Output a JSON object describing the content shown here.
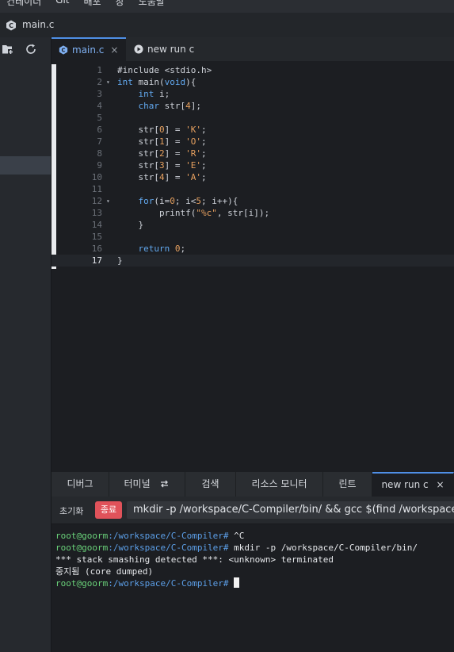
{
  "menu": {
    "items": [
      "컨테이너",
      "Git",
      "배포",
      "창",
      "도움말"
    ]
  },
  "window": {
    "title": "main.c"
  },
  "editor_tabs": [
    {
      "label": "main.c",
      "close": "×",
      "active": true
    },
    {
      "label": "new run c",
      "active": false
    }
  ],
  "code_lines": [
    {
      "n": "1",
      "fold": "",
      "html": "#include &lt;stdio.h&gt;"
    },
    {
      "n": "2",
      "fold": "▾",
      "html": "<span class='kw'>int</span> main(<span class='kw'>void</span>){"
    },
    {
      "n": "3",
      "fold": "",
      "html": "    <span class='kw'>int</span> i;"
    },
    {
      "n": "4",
      "fold": "",
      "html": "    <span class='kw'>char</span> str[<span class='num'>4</span>];"
    },
    {
      "n": "5",
      "fold": "",
      "html": ""
    },
    {
      "n": "6",
      "fold": "",
      "html": "    str[<span class='num'>0</span>] = <span class='str'>'K'</span>;"
    },
    {
      "n": "7",
      "fold": "",
      "html": "    str[<span class='num'>1</span>] = <span class='str'>'O'</span>;"
    },
    {
      "n": "8",
      "fold": "",
      "html": "    str[<span class='num'>2</span>] = <span class='str'>'R'</span>;"
    },
    {
      "n": "9",
      "fold": "",
      "html": "    str[<span class='num'>3</span>] = <span class='str'>'E'</span>;"
    },
    {
      "n": "10",
      "fold": "",
      "html": "    str[<span class='num'>4</span>] = <span class='str'>'A'</span>;"
    },
    {
      "n": "11",
      "fold": "",
      "html": ""
    },
    {
      "n": "12",
      "fold": "▾",
      "html": "    <span class='kw'>for</span>(i=<span class='num'>0</span>; i&lt;<span class='num'>5</span>; i++){"
    },
    {
      "n": "13",
      "fold": "",
      "html": "        printf(<span class='str'>\"%c\"</span>, str[i]);"
    },
    {
      "n": "14",
      "fold": "",
      "html": "    }"
    },
    {
      "n": "15",
      "fold": "",
      "html": ""
    },
    {
      "n": "16",
      "fold": "",
      "html": "    <span class='kw'>return</span> <span class='num'>0</span>;"
    },
    {
      "n": "17",
      "fold": "",
      "html": "}",
      "current": true
    }
  ],
  "bottom_tabs": [
    {
      "label": "디버그"
    },
    {
      "label": "터미널",
      "icon": "refresh-icon"
    },
    {
      "label": "검색"
    },
    {
      "label": "리소스 모니터"
    },
    {
      "label": "린트"
    },
    {
      "label": "new run c",
      "close": "×",
      "active": true
    }
  ],
  "run": {
    "init_label": "초기화",
    "stop_label": "종료",
    "command": "mkdir -p /workspace/C-Compiler/bin/ && gcc $(find /workspace"
  },
  "terminal": {
    "prompt_user": "root@goorm",
    "prompt_path": ":/workspace/C-Compiler#",
    "lines": [
      {
        "type": "prompt",
        "text": " ^C"
      },
      {
        "type": "prompt",
        "text": " mkdir -p /workspace/C-Compiler/bin/"
      },
      {
        "type": "out",
        "text": "*** stack smashing detected ***: <unknown> terminated"
      },
      {
        "type": "out",
        "text": "중지됨 (core dumped)"
      },
      {
        "type": "prompt",
        "text": " ",
        "cursor": true
      }
    ]
  },
  "colors": {
    "accent": "#4f8fe6",
    "stop": "#e0525a",
    "keyword": "#62a9f0",
    "string": "#e6a05f"
  }
}
